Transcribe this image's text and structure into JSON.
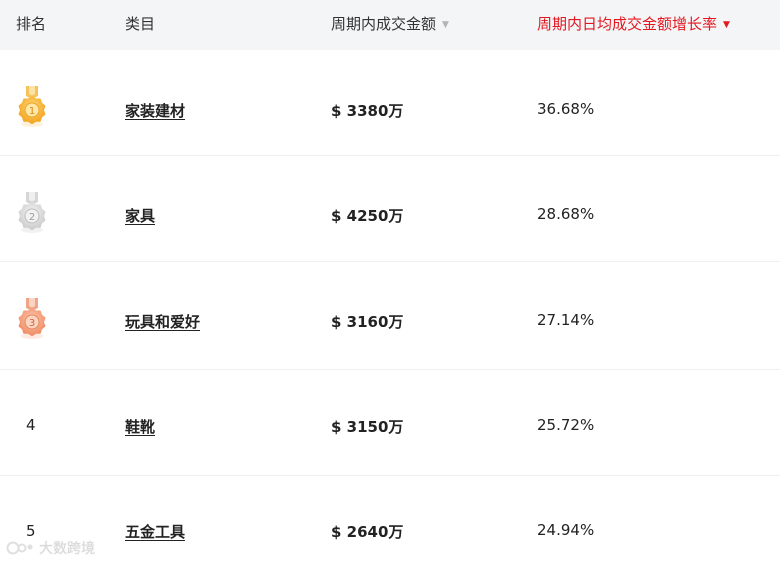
{
  "header": {
    "rank": "排名",
    "category": "类目",
    "amount": "周期内成交金额",
    "growth": "周期内日均成交金额增长率",
    "amount_sort_icon": "sort-down-icon",
    "growth_sort_icon": "sort-down-icon",
    "accent_color": "#e4171f"
  },
  "rows": [
    {
      "rank": "1",
      "medal": "gold",
      "category": "家装建材",
      "amount": "$ 3380万",
      "growth": "36.68%"
    },
    {
      "rank": "2",
      "medal": "silver",
      "category": "家具",
      "amount": "$ 4250万",
      "growth": "28.68%"
    },
    {
      "rank": "3",
      "medal": "bronze",
      "category": "玩具和爱好",
      "amount": "$ 3160万",
      "growth": "27.14%"
    },
    {
      "rank": "4",
      "medal": null,
      "category": "鞋靴",
      "amount": "$ 3150万",
      "growth": "25.72%"
    },
    {
      "rank": "5",
      "medal": null,
      "category": "五金工具",
      "amount": "$ 2640万",
      "growth": "24.94%"
    }
  ],
  "watermark": {
    "text": "大数跨境"
  }
}
